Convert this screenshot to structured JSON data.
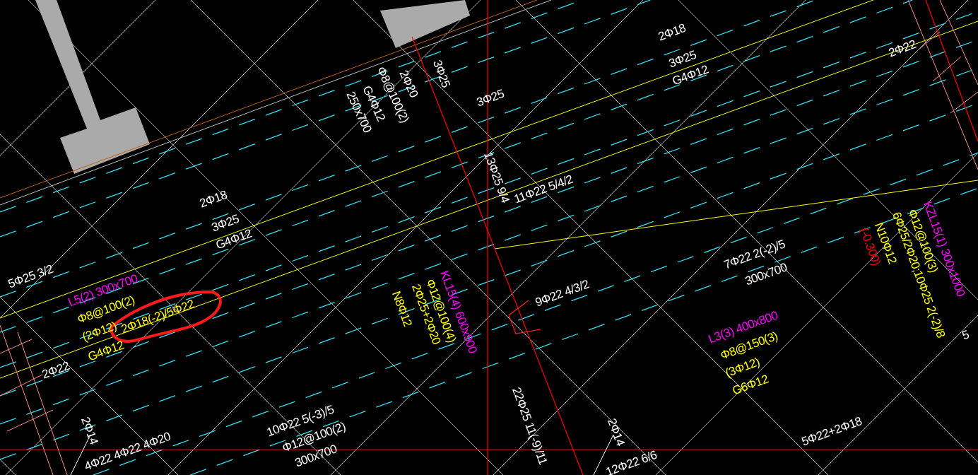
{
  "annotations": [
    {
      "text": "2Φ18",
      "color": "#ffffff"
    },
    {
      "text": "3Φ25",
      "color": "#ffffff"
    },
    {
      "text": "G4Φ12",
      "color": "#ffffff"
    },
    {
      "text": "5Φ25 3/2",
      "color": "#ffffff"
    },
    {
      "text": "L5(2) 300x700",
      "color": "#ff00ff"
    },
    {
      "text": "Φ8@100(2)",
      "color": "#ffff00"
    },
    {
      "text": "(2Φ12)",
      "color": "#ffff00"
    },
    {
      "text": "2Φ18(-2)/5Φ22",
      "color": "#ffff00"
    },
    {
      "text": "G4Φ12",
      "color": "#ffff00"
    },
    {
      "text": "2Φ22",
      "color": "#ffffff"
    },
    {
      "text": "2Φ14",
      "color": "#ffffff"
    },
    {
      "text": "4Φ22 4Φ22 4Φ20",
      "color": "#ffffff"
    },
    {
      "text": "10Φ22 5(-3)/5",
      "color": "#ffffff"
    },
    {
      "text": "Φ12@100(2)",
      "color": "#ffffff"
    },
    {
      "text": "300x700",
      "color": "#ffffff"
    },
    {
      "text": "250x700",
      "color": "#ffffff"
    },
    {
      "text": "G4Φ12",
      "color": "#ffffff"
    },
    {
      "text": "Φ8@100(2)",
      "color": "#ffffff"
    },
    {
      "text": "2Φ20",
      "color": "#ffffff"
    },
    {
      "text": "3Φ25",
      "color": "#ffffff"
    },
    {
      "text": "3Φ25",
      "color": "#ffffff"
    },
    {
      "text": "13Φ25 9/4",
      "color": "#ffffff"
    },
    {
      "text": "11Φ22 5/4/2",
      "color": "#ffffff"
    },
    {
      "text": "2Φ18",
      "color": "#ffffff"
    },
    {
      "text": "3Φ25",
      "color": "#ffffff"
    },
    {
      "text": "G4Φ12",
      "color": "#ffffff"
    },
    {
      "text": "2Φ22",
      "color": "#ffffff"
    },
    {
      "text": "KL15(4) 600x900",
      "color": "#ff00ff"
    },
    {
      "text": "Φ12@100(4)",
      "color": "#ffff00"
    },
    {
      "text": "2Φ25+2Φ20",
      "color": "#ffff00"
    },
    {
      "text": "N8Φ12",
      "color": "#ffff00"
    },
    {
      "text": "9Φ22 4/3/2",
      "color": "#ffffff"
    },
    {
      "text": "7Φ22 2(-2)/5",
      "color": "#ffffff"
    },
    {
      "text": "300x700",
      "color": "#ffffff"
    },
    {
      "text": "22Φ25 11(-9)/11",
      "color": "#ffffff"
    },
    {
      "text": "2Φ14",
      "color": "#ffffff"
    },
    {
      "text": "12Φ22 6/6",
      "color": "#ffffff"
    },
    {
      "text": "L3(3) 400x800",
      "color": "#ff00ff"
    },
    {
      "text": "Φ8@150(3)",
      "color": "#ffff00"
    },
    {
      "text": "(3Φ12)",
      "color": "#ffff00"
    },
    {
      "text": "G6Φ12",
      "color": "#ffff00"
    },
    {
      "text": "5Φ22+2Φ18",
      "color": "#ffffff"
    },
    {
      "text": "KZL15(1) 300x1000",
      "color": "#ff00ff"
    },
    {
      "text": "Φ12@100(3)",
      "color": "#ffff00"
    },
    {
      "text": "6Φ25/2Φ20;10Φ25 2(-2)/8",
      "color": "#ffff00"
    },
    {
      "text": "N10Φ12",
      "color": "#ffff00"
    },
    {
      "text": "(-0.300)",
      "color": "#ff0000"
    },
    {
      "text": "5",
      "color": "#ffffff"
    }
  ]
}
